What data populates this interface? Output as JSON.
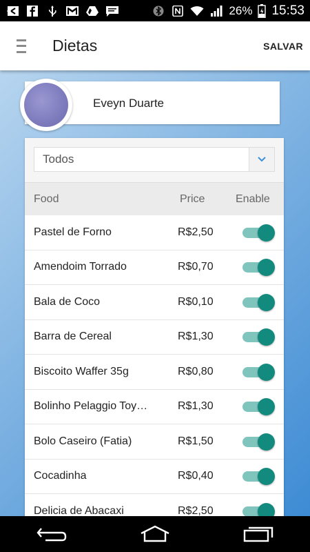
{
  "status_bar": {
    "icons_left": [
      "back-arrow-notification-icon",
      "facebook-icon",
      "usb-icon",
      "gmail-icon",
      "drive-icon",
      "message-icon"
    ],
    "icons_right": [
      "bluetooth-icon",
      "nfc-icon",
      "wifi-icon",
      "signal-icon",
      "battery-icon"
    ],
    "battery": "26%",
    "time": "15:53"
  },
  "app_bar": {
    "title": "Dietas",
    "save_label": "SALVAR"
  },
  "profile": {
    "name": "Eveyn Duarte"
  },
  "filter": {
    "selected": "Todos"
  },
  "table": {
    "headers": {
      "food": "Food",
      "price": "Price",
      "enable": "Enable"
    },
    "rows": [
      {
        "food": "Pastel de Forno",
        "price": "R$2,50",
        "enabled": true
      },
      {
        "food": "Amendoim Torrado",
        "price": "R$0,70",
        "enabled": true
      },
      {
        "food": "Bala de Coco",
        "price": "R$0,10",
        "enabled": true
      },
      {
        "food": "Barra de Cereal",
        "price": "R$1,30",
        "enabled": true
      },
      {
        "food": "Biscoito Waffer 35g",
        "price": "R$0,80",
        "enabled": true
      },
      {
        "food": "Bolinho Pelaggio Toy…",
        "price": "R$1,30",
        "enabled": true
      },
      {
        "food": "Bolo Caseiro (Fatia)",
        "price": "R$1,50",
        "enabled": true
      },
      {
        "food": "Cocadinha",
        "price": "R$0,40",
        "enabled": true
      },
      {
        "food": "Delicia de Abacaxi",
        "price": "R$2,50",
        "enabled": true
      }
    ]
  },
  "colors": {
    "toggle_on_thumb": "#128a7e",
    "toggle_on_track": "#7fc4bd",
    "background_gradient_end": "#3d8bd4"
  }
}
